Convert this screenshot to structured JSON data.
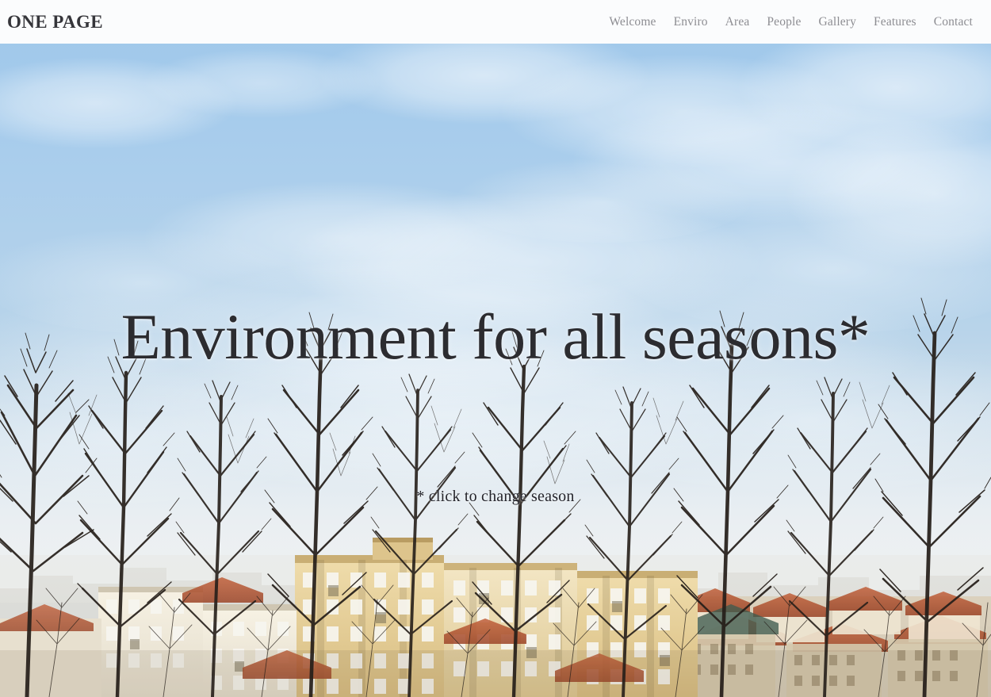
{
  "header": {
    "brand": "ONE PAGE",
    "nav": [
      {
        "label": "Welcome"
      },
      {
        "label": "Enviro"
      },
      {
        "label": "Area"
      },
      {
        "label": "People"
      },
      {
        "label": "Gallery"
      },
      {
        "label": "Features"
      },
      {
        "label": "Contact"
      }
    ]
  },
  "hero": {
    "headline": "Environment for all seasons*",
    "subtitle": "* click to change season",
    "season": "winter",
    "colors": {
      "header_bg": "#fbfcfd",
      "brand_text": "#35353a",
      "nav_text": "#8d8d92",
      "headline_text": "#2c2c30",
      "subtitle_text": "#23232a",
      "sky_top": "#9cc6e9",
      "sky_bottom": "#d8e3ec",
      "cloud": "#ffffff",
      "building_warm": "#e3c88a",
      "building_light": "#f0e3c6",
      "roof_red": "#b1542f",
      "branch": "#2a2420"
    }
  }
}
